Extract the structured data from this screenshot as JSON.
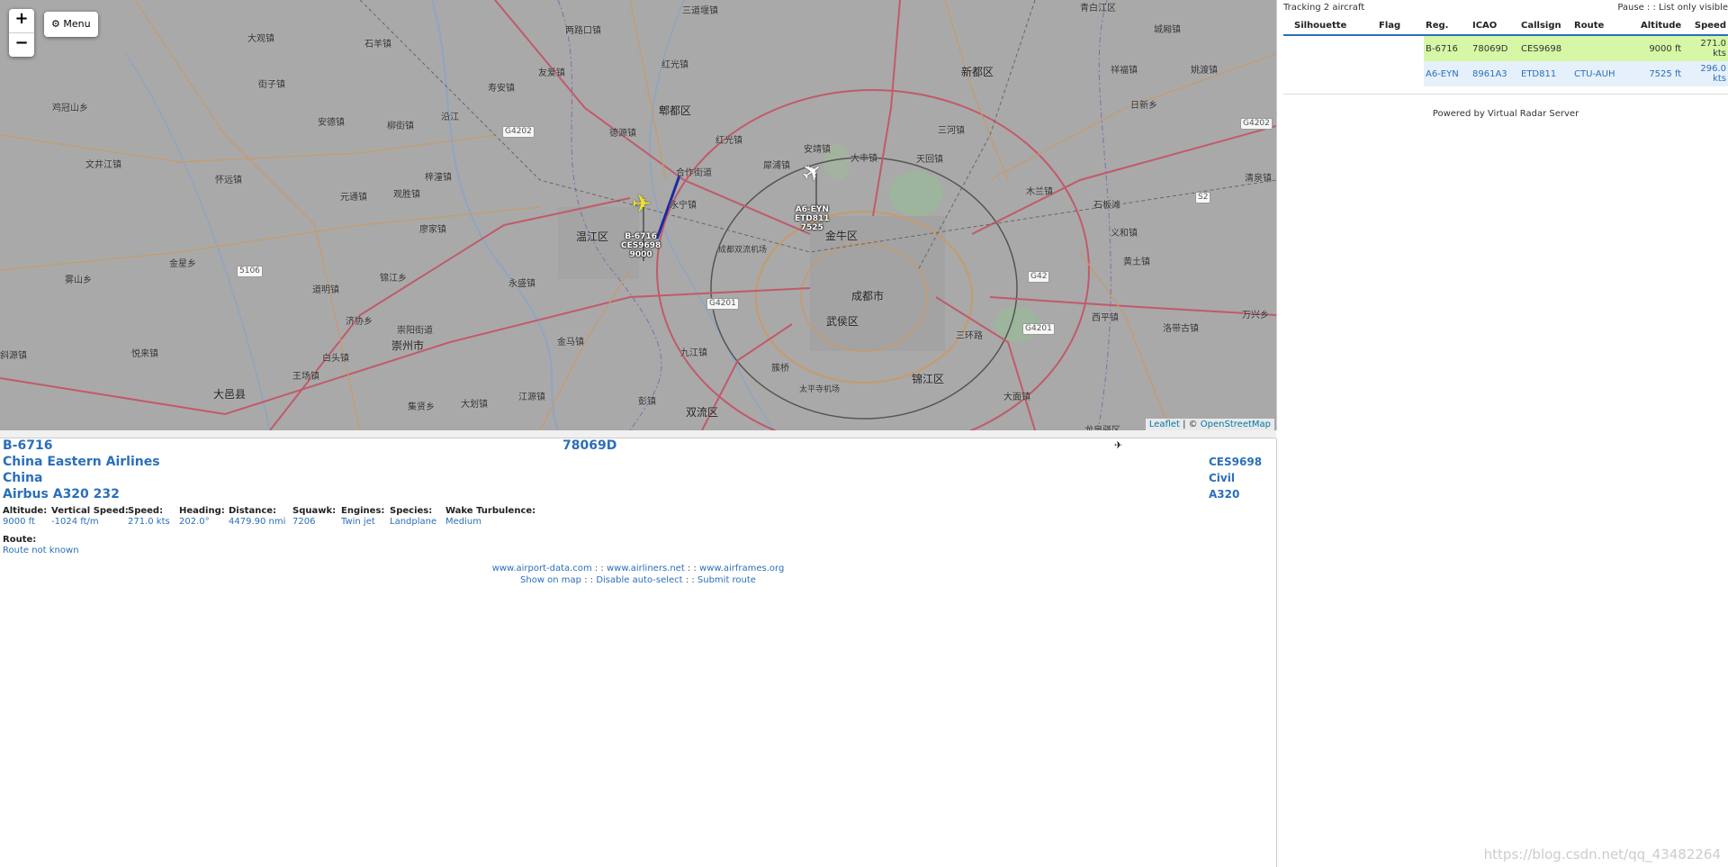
{
  "map": {
    "zoom_in": "+",
    "zoom_out": "−",
    "menu_label": "Menu",
    "attribution": {
      "leaflet": "Leaflet",
      "sep": " | © ",
      "osm": "OpenStreetMap"
    },
    "places": [
      {
        "text": "三道堰镇"
      },
      {
        "text": "青白江区"
      },
      {
        "text": "大观镇"
      },
      {
        "text": "石羊镇"
      },
      {
        "text": "两路口镇"
      },
      {
        "text": "红光镇"
      },
      {
        "text": "友爱镇"
      },
      {
        "text": "寿安镇"
      },
      {
        "text": "沿江"
      },
      {
        "text": "郫都区"
      },
      {
        "text": "新都区"
      },
      {
        "text": "城厢镇"
      },
      {
        "text": "姚渡镇"
      },
      {
        "text": "鸡冠山乡"
      },
      {
        "text": "街子镇"
      },
      {
        "text": "安德镇"
      },
      {
        "text": "柳街镇"
      },
      {
        "text": "德源镇"
      },
      {
        "text": "红光镇"
      },
      {
        "text": "安靖镇"
      },
      {
        "text": "大丰镇"
      },
      {
        "text": "天回镇"
      },
      {
        "text": "三河镇"
      },
      {
        "text": "文井江镇"
      },
      {
        "text": "怀远镇"
      },
      {
        "text": "元通镇"
      },
      {
        "text": "梓潼镇"
      },
      {
        "text": "观胜镇"
      },
      {
        "text": "合作街道"
      },
      {
        "text": "永宁镇"
      },
      {
        "text": "犀浦镇"
      },
      {
        "text": "木兰镇"
      },
      {
        "text": "石板滩"
      },
      {
        "text": "廖家镇"
      },
      {
        "text": "温江区"
      },
      {
        "text": "金牛区"
      },
      {
        "text": "义和镇"
      },
      {
        "text": "金星乡"
      },
      {
        "text": "雾山乡"
      },
      {
        "text": "道明镇"
      },
      {
        "text": "锦江乡"
      },
      {
        "text": "永盛镇"
      },
      {
        "text": "成都市"
      },
      {
        "text": "黄土镇"
      },
      {
        "text": "济协乡"
      },
      {
        "text": "崇阳街道"
      },
      {
        "text": "崇州市"
      },
      {
        "text": "白头镇"
      },
      {
        "text": "金马镇"
      },
      {
        "text": "武侯区"
      },
      {
        "text": "西平镇"
      },
      {
        "text": "洛带古镇"
      },
      {
        "text": "万兴乡"
      },
      {
        "text": "斜源镇"
      },
      {
        "text": "悦来镇"
      },
      {
        "text": "王场镇"
      },
      {
        "text": "九江镇"
      },
      {
        "text": "簇桥"
      },
      {
        "text": "三环路"
      },
      {
        "text": "锦江区"
      },
      {
        "text": "大邑县"
      },
      {
        "text": "集贤乡"
      },
      {
        "text": "大划镇"
      },
      {
        "text": "江源镇"
      },
      {
        "text": "彭镇"
      },
      {
        "text": "双流区"
      },
      {
        "text": "大面镇"
      },
      {
        "text": "龙泉驿区"
      },
      {
        "text": "日新乡"
      },
      {
        "text": "祥福镇"
      },
      {
        "text": "清泉镇"
      },
      {
        "text": "成都双流机场"
      },
      {
        "text": "太平寺机场"
      }
    ],
    "roads": [
      "G4202",
      "G4202",
      "S2",
      "G42",
      "G4201",
      "G4201",
      "5106"
    ],
    "aircraft": [
      {
        "reg": "B-6716",
        "callsign": "CES9698",
        "alt": "9000"
      },
      {
        "reg": "A6-EYN",
        "callsign": "ETD811",
        "alt": "7525"
      }
    ]
  },
  "detail": {
    "registration": "B-6716",
    "icao": "78069D",
    "operator": "China Eastern Airlines",
    "country": "China",
    "model": "Airbus A320 232",
    "callsign": "CES9698",
    "type": "Civil",
    "icao_type": "A320",
    "fields": [
      {
        "label": "Altitude:",
        "value": "9000 ft"
      },
      {
        "label": "Vertical Speed:",
        "value": "-1024 ft/m"
      },
      {
        "label": "Speed:",
        "value": "271.0 kts"
      },
      {
        "label": "Heading:",
        "value": "202.0°"
      },
      {
        "label": "Distance:",
        "value": "4479.90 nmi"
      },
      {
        "label": "Squawk:",
        "value": "7206"
      },
      {
        "label": "Engines:",
        "value": "Twin jet"
      },
      {
        "label": "Species:",
        "value": "Landplane"
      },
      {
        "label": "Wake Turbulence:",
        "value": "Medium"
      }
    ],
    "route_label": "Route:",
    "route_value": "Route not known",
    "links1": [
      "www.airport-data.com",
      "www.airliners.net",
      "www.airframes.org"
    ],
    "links2": [
      "Show on map",
      "Disable auto-select",
      "Submit route"
    ],
    "sep": " : : "
  },
  "list": {
    "tracking": "Tracking 2 aircraft",
    "pause": "Pause",
    "sep": " : : ",
    "visible": "List only visible",
    "columns": [
      "Silhouette",
      "Flag",
      "Reg.",
      "ICAO",
      "Callsign",
      "Route",
      "Altitude",
      "Speed"
    ],
    "rows": [
      {
        "reg": "B-6716",
        "icao": "78069D",
        "callsign": "CES9698",
        "route": "",
        "altitude": "9000 ft",
        "speed": "271.0 kts"
      },
      {
        "reg": "A6-EYN",
        "icao": "8961A3",
        "callsign": "ETD811",
        "route": "CTU-AUH",
        "altitude": "7525 ft",
        "speed": "296.0 kts"
      }
    ],
    "powered": "Powered by Virtual Radar Server"
  },
  "watermark": "https://blog.csdn.net/qq_43482264"
}
